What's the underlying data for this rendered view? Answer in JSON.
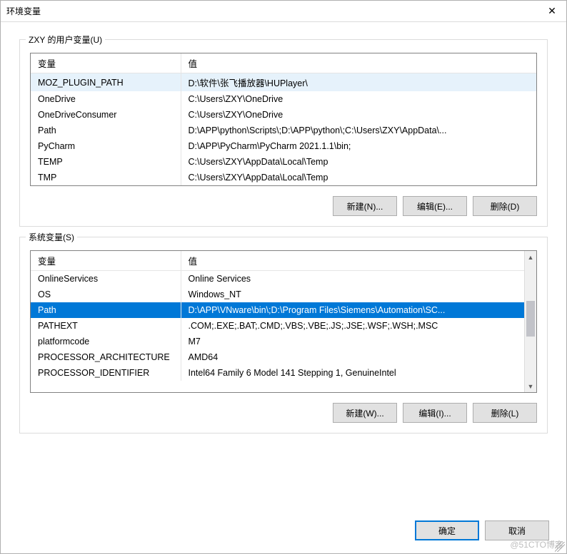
{
  "titlebar": {
    "title": "环境变量"
  },
  "user_section": {
    "label": "ZXY 的用户变量(U)",
    "columns": {
      "var": "变量",
      "val": "值"
    },
    "rows": [
      {
        "var": "MOZ_PLUGIN_PATH",
        "val": "D:\\软件\\张飞播放器\\HUPlayer\\",
        "hover": true
      },
      {
        "var": "OneDrive",
        "val": "C:\\Users\\ZXY\\OneDrive"
      },
      {
        "var": "OneDriveConsumer",
        "val": "C:\\Users\\ZXY\\OneDrive"
      },
      {
        "var": "Path",
        "val": "D:\\APP\\python\\Scripts\\;D:\\APP\\python\\;C:\\Users\\ZXY\\AppData\\..."
      },
      {
        "var": "PyCharm",
        "val": "D:\\APP\\PyCharm\\PyCharm 2021.1.1\\bin;"
      },
      {
        "var": "TEMP",
        "val": "C:\\Users\\ZXY\\AppData\\Local\\Temp"
      },
      {
        "var": "TMP",
        "val": "C:\\Users\\ZXY\\AppData\\Local\\Temp"
      }
    ],
    "buttons": {
      "new": "新建(N)...",
      "edit": "编辑(E)...",
      "delete": "删除(D)"
    }
  },
  "system_section": {
    "label": "系统变量(S)",
    "columns": {
      "var": "变量",
      "val": "值"
    },
    "rows": [
      {
        "var": "OnlineServices",
        "val": "Online Services"
      },
      {
        "var": "OS",
        "val": "Windows_NT"
      },
      {
        "var": "Path",
        "val": "D:\\APP\\VNware\\bin\\;D:\\Program Files\\Siemens\\Automation\\SC...",
        "selected": true
      },
      {
        "var": "PATHEXT",
        "val": ".COM;.EXE;.BAT;.CMD;.VBS;.VBE;.JS;.JSE;.WSF;.WSH;.MSC"
      },
      {
        "var": "platformcode",
        "val": "M7"
      },
      {
        "var": "PROCESSOR_ARCHITECTURE",
        "val": "AMD64"
      },
      {
        "var": "PROCESSOR_IDENTIFIER",
        "val": "Intel64 Family 6 Model 141 Stepping 1, GenuineIntel"
      }
    ],
    "buttons": {
      "new": "新建(W)...",
      "edit": "编辑(I)...",
      "delete": "删除(L)"
    }
  },
  "dialog_buttons": {
    "ok": "确定",
    "cancel": "取消"
  },
  "watermark": "@51CTO博客"
}
